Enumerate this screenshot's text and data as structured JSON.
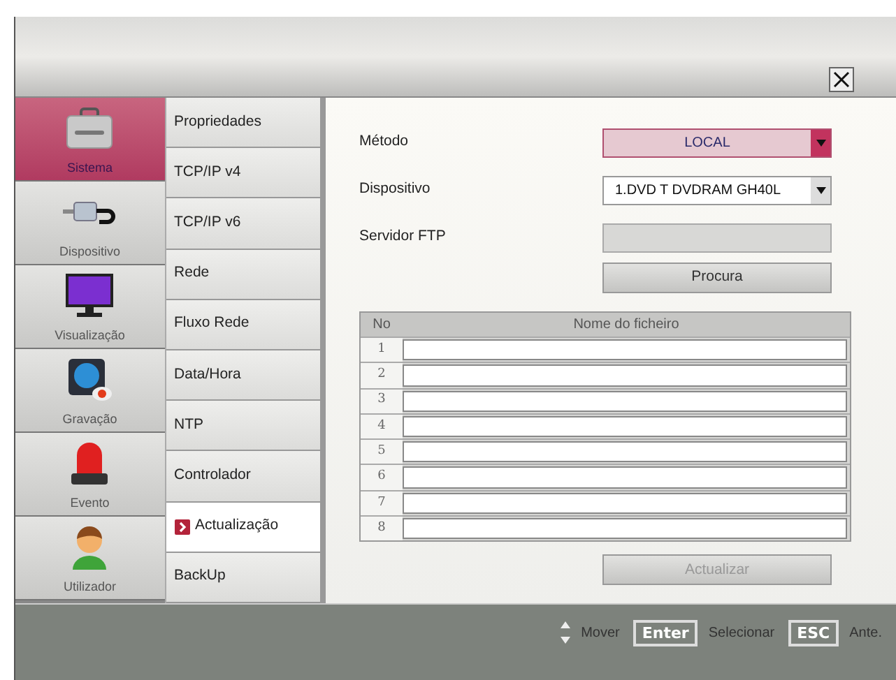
{
  "categories": [
    {
      "label": "Sistema",
      "kind": "toolbox",
      "selected": true
    },
    {
      "label": "Dispositivo",
      "kind": "plug",
      "selected": false
    },
    {
      "label": "Visualização",
      "kind": "monitor",
      "selected": false
    },
    {
      "label": "Gravação",
      "kind": "camera",
      "selected": false
    },
    {
      "label": "Evento",
      "kind": "siren",
      "selected": false
    },
    {
      "label": "Utilizador",
      "kind": "user",
      "selected": false
    }
  ],
  "submenu": [
    {
      "label": "Propriedades",
      "selected": false
    },
    {
      "label": "TCP/IP v4",
      "selected": false
    },
    {
      "label": "TCP/IP v6",
      "selected": false
    },
    {
      "label": "Rede",
      "selected": false
    },
    {
      "label": "Fluxo Rede",
      "selected": false
    },
    {
      "label": "Data/Hora",
      "selected": false
    },
    {
      "label": "NTP",
      "selected": false
    },
    {
      "label": "Controlador",
      "selected": false
    },
    {
      "label": "Actualização",
      "selected": true
    },
    {
      "label": "BackUp",
      "selected": false
    }
  ],
  "form": [
    {
      "label": "Método",
      "kind": "select",
      "value": "LOCAL",
      "highlighted": true
    },
    {
      "label": "Dispositivo",
      "kind": "select",
      "value": "1.DVD T DVDRAM GH40L",
      "highlighted": false
    },
    {
      "label": "Servidor FTP",
      "kind": "input",
      "disabled": true
    }
  ],
  "search_button": "Procura",
  "table": {
    "columns": [
      "No",
      "Nome do ficheiro"
    ],
    "rows": [
      "1",
      "2",
      "3",
      "4",
      "5",
      "6",
      "7",
      "8"
    ]
  },
  "update_button": {
    "label": "Actualizar",
    "disabled": true
  },
  "footer": [
    {
      "kind": "arrows",
      "label": "Mover"
    },
    {
      "kind": "key",
      "key": "Enter",
      "label": "Selecionar"
    },
    {
      "kind": "key",
      "key": "ESC",
      "label": "Ante."
    }
  ]
}
